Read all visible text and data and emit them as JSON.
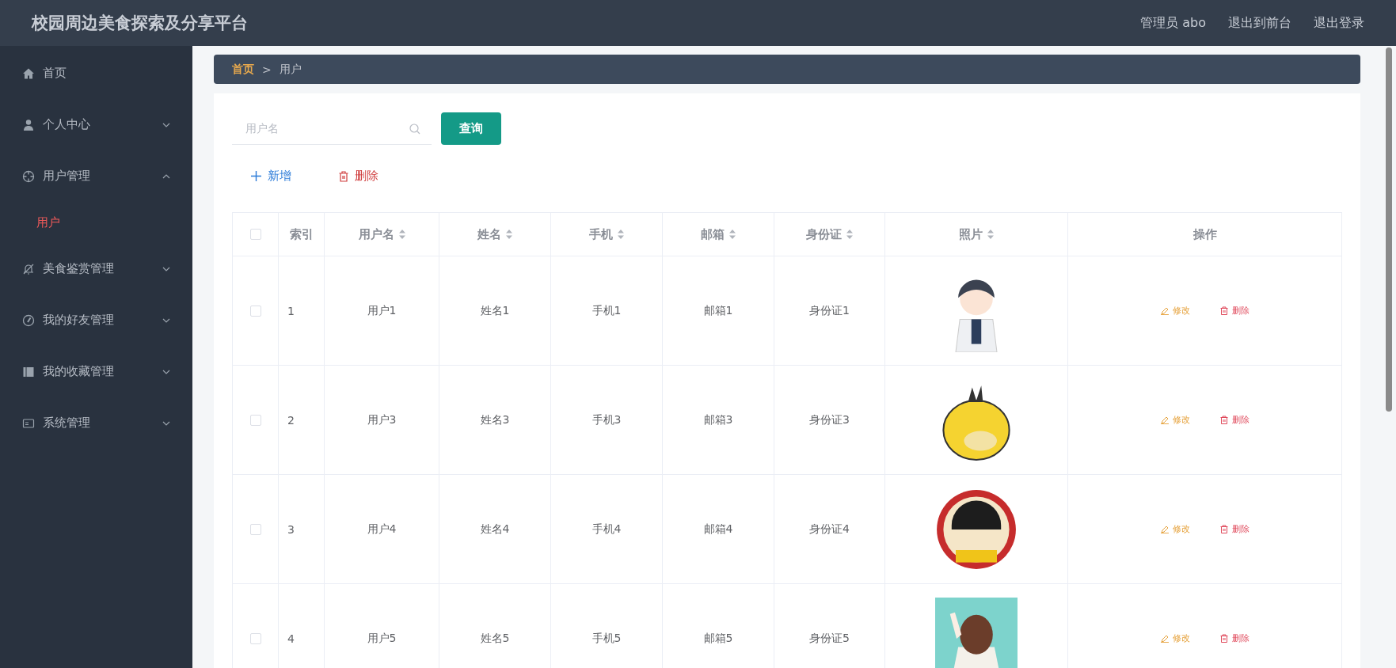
{
  "header": {
    "title": "校园周边美食探索及分享平台",
    "links": [
      "管理员 abo",
      "退出到前台",
      "退出登录"
    ]
  },
  "sidebar": {
    "items": [
      {
        "label": "首页",
        "expandable": false,
        "selected": false
      },
      {
        "label": "个人中心",
        "expandable": true,
        "expanded": false,
        "selected": false
      },
      {
        "label": "用户管理",
        "expandable": true,
        "expanded": true,
        "selected": false,
        "children": [
          {
            "label": "用户",
            "selected": true
          }
        ]
      },
      {
        "label": "美食鉴赏管理",
        "expandable": true,
        "expanded": false,
        "selected": false
      },
      {
        "label": "我的好友管理",
        "expandable": true,
        "expanded": false,
        "selected": false
      },
      {
        "label": "我的收藏管理",
        "expandable": true,
        "expanded": false,
        "selected": false
      },
      {
        "label": "系统管理",
        "expandable": true,
        "expanded": false,
        "selected": false
      }
    ]
  },
  "breadcrumb": {
    "separator": ">",
    "items": [
      "首页",
      "用户"
    ]
  },
  "search": {
    "placeholder": "用户名",
    "button": "查询"
  },
  "toolbar": [
    "新增",
    "删除"
  ],
  "table": {
    "select_all_checked": false,
    "columns": [
      {
        "label": "索引",
        "sortable": false
      },
      {
        "label": "用户名",
        "sortable": true
      },
      {
        "label": "姓名",
        "sortable": true
      },
      {
        "label": "手机",
        "sortable": true
      },
      {
        "label": "邮箱",
        "sortable": true
      },
      {
        "label": "身份证",
        "sortable": true
      },
      {
        "label": "照片",
        "sortable": true
      },
      {
        "label": "操作",
        "sortable": false
      }
    ],
    "rows": [
      {
        "checked": false,
        "cells": [
          "1",
          "用户1",
          "姓名1",
          "手机1",
          "邮箱1",
          "身份证1"
        ],
        "photo": {
          "kind": "picture"
        },
        "actions": [
          "修改",
          "删除"
        ]
      },
      {
        "checked": false,
        "cells": [
          "2",
          "用户3",
          "姓名3",
          "手机3",
          "邮箱3",
          "身份证3"
        ],
        "photo": {
          "kind": "picture"
        },
        "actions": [
          "修改",
          "删除"
        ]
      },
      {
        "checked": false,
        "cells": [
          "3",
          "用户4",
          "姓名4",
          "手机4",
          "邮箱4",
          "身份证4"
        ],
        "photo": {
          "kind": "picture"
        },
        "actions": [
          "修改",
          "删除"
        ]
      },
      {
        "checked": false,
        "cells": [
          "4",
          "用户5",
          "姓名5",
          "手机5",
          "邮箱5",
          "身份证5"
        ],
        "photo": {
          "kind": "picture"
        },
        "actions": [
          "修改",
          "删除"
        ]
      }
    ]
  }
}
